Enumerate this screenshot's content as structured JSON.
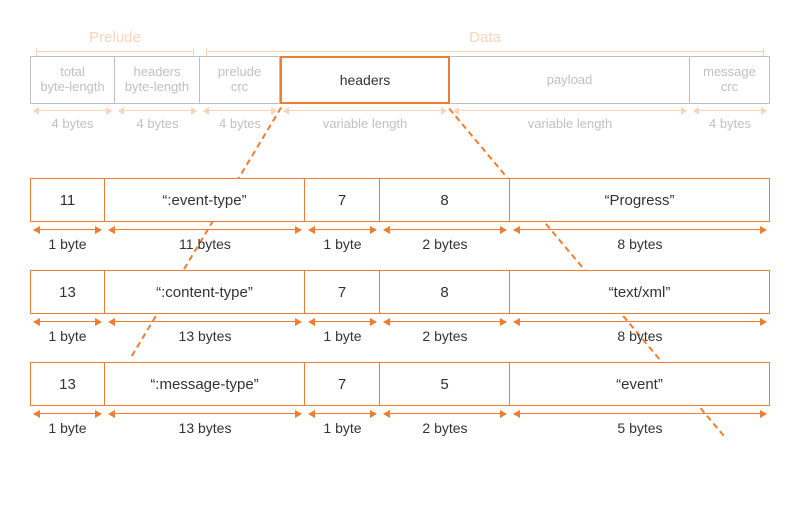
{
  "top_groups": {
    "prelude": "Prelude",
    "data": "Data"
  },
  "top_cells": {
    "total": "total\nbyte-length",
    "hlen": "headers\nbyte-length",
    "pcrc": "prelude\ncrc",
    "headers": "headers",
    "payload": "payload",
    "mcrc": "message\ncrc"
  },
  "top_dims": {
    "total": "4 bytes",
    "hlen": "4 bytes",
    "pcrc": "4 bytes",
    "headers": "variable length",
    "payload": "variable length",
    "mcrc": "4 bytes"
  },
  "records": [
    {
      "cells": [
        "11",
        "“:event-type”",
        "7",
        "8",
        "“Progress”"
      ],
      "dims": [
        "1 byte",
        "11 bytes",
        "1 byte",
        "2 bytes",
        "8 bytes"
      ]
    },
    {
      "cells": [
        "13",
        "“:content-type”",
        "7",
        "8",
        "“text/xml”"
      ],
      "dims": [
        "1 byte",
        "13 bytes",
        "1 byte",
        "2 bytes",
        "8 bytes"
      ]
    },
    {
      "cells": [
        "13",
        "“:message-type”",
        "7",
        "5",
        "“event”"
      ],
      "dims": [
        "1 byte",
        "13 bytes",
        "1 byte",
        "2 bytes",
        "5 bytes"
      ]
    }
  ]
}
